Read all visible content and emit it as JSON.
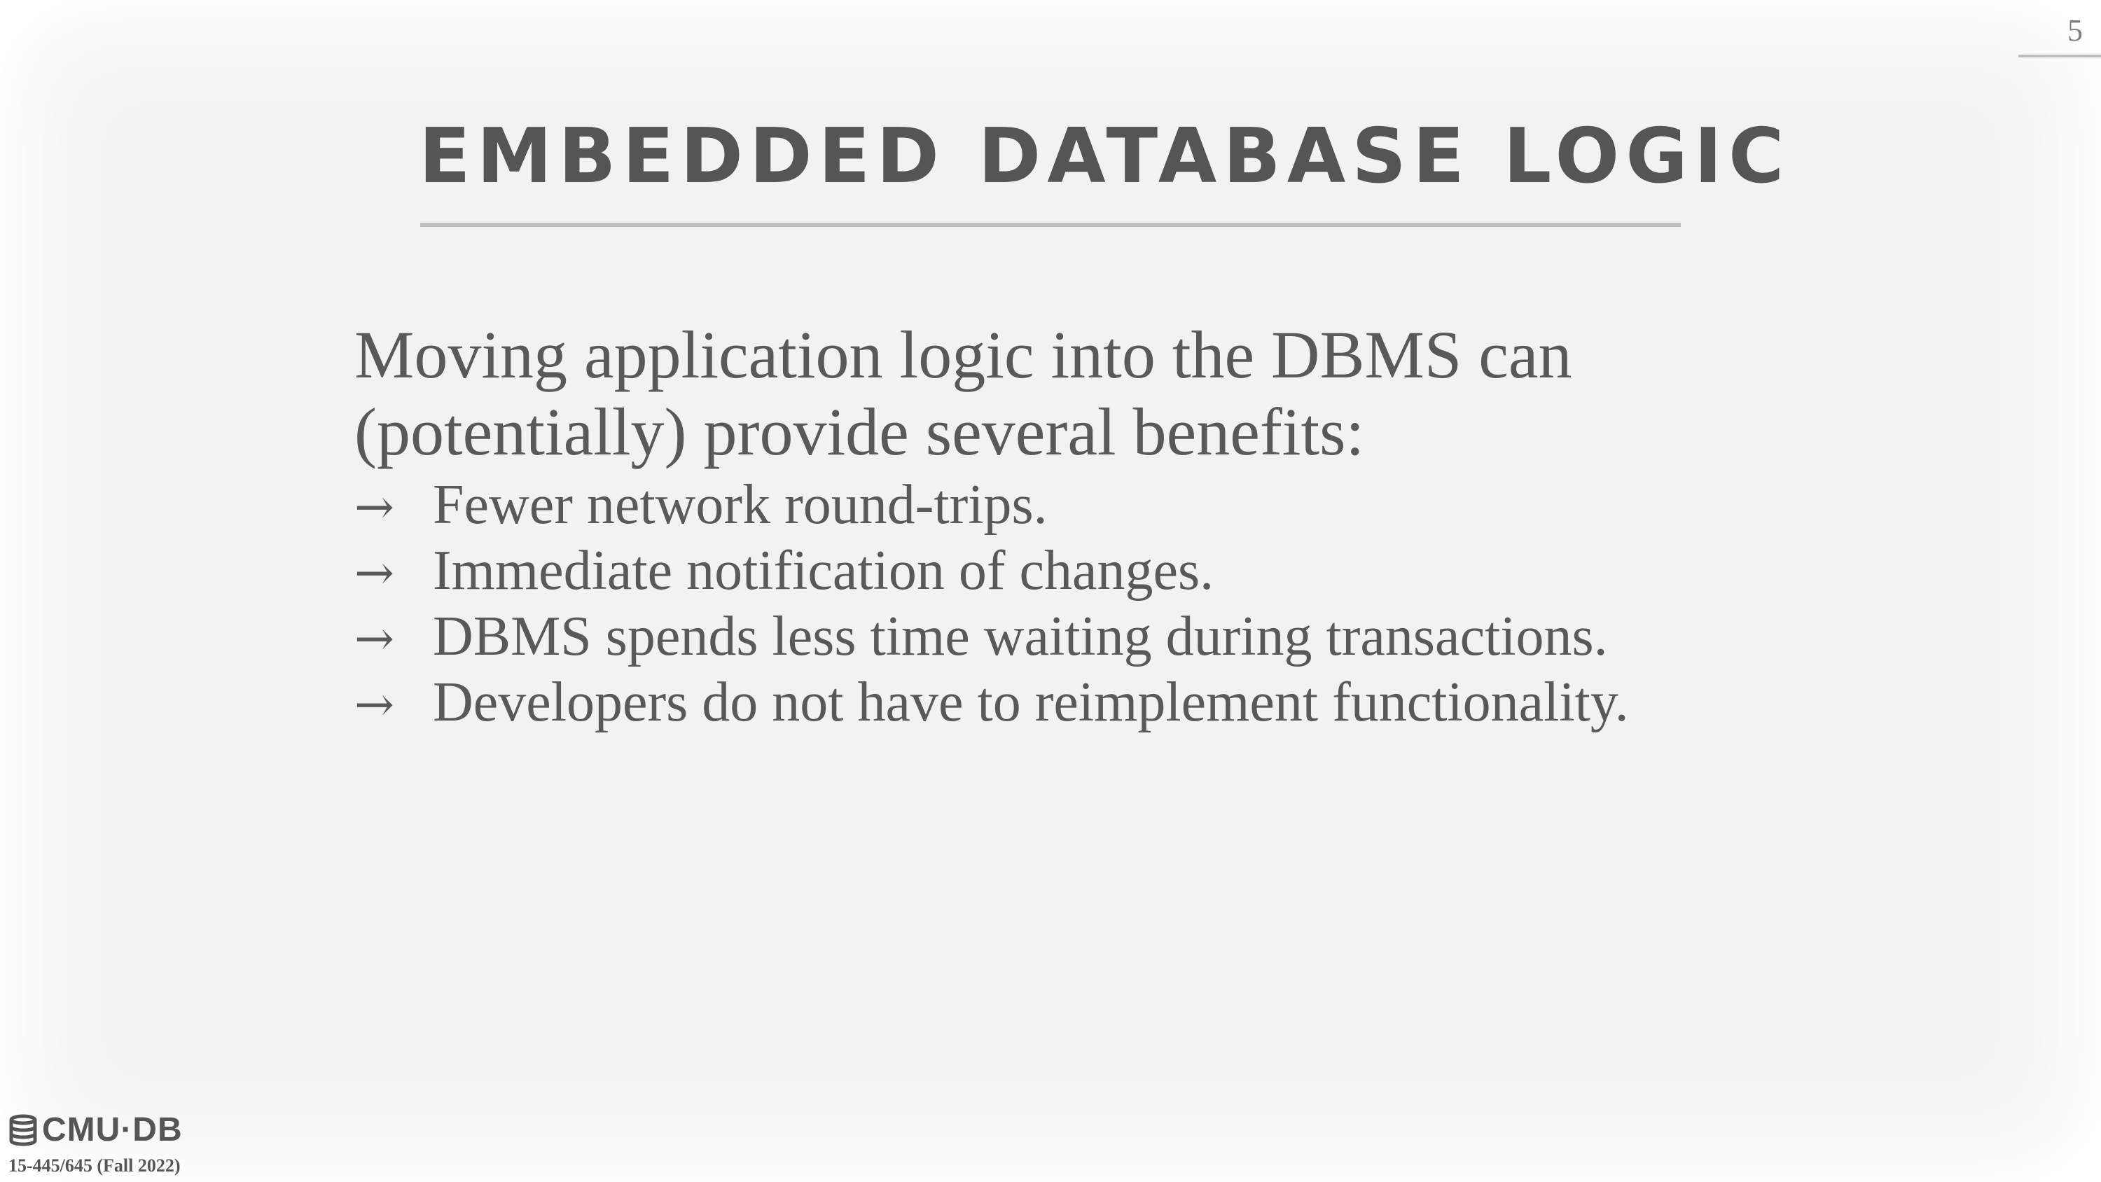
{
  "slide": {
    "page_number": "5",
    "title": "EMBEDDED DATABASE LOGIC",
    "lead": "Moving application logic into the DBMS can (potentially) provide several benefits:",
    "bullet_marker": "→",
    "bullets": [
      "Fewer network round-trips.",
      "Immediate notification of changes.",
      "DBMS spends less time waiting during transactions.",
      "Developers do not have to reimplement functionality."
    ]
  },
  "footer": {
    "logo_text": "CMU·DB",
    "logo_icon": "database-stack-icon",
    "course": "15-445/645 (Fall 2022)"
  },
  "colors": {
    "background": "#f2f2f2",
    "text": "#595959",
    "title": "#555555",
    "rule": "#bfbfbf"
  }
}
